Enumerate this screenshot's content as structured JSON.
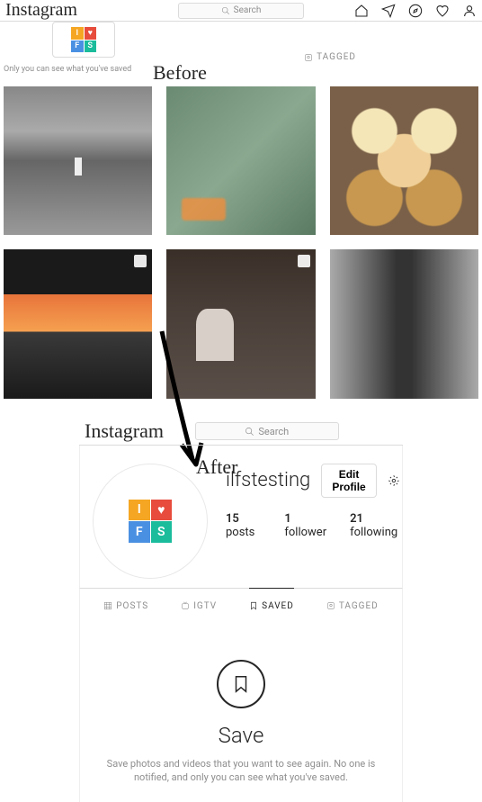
{
  "before_label": "Before",
  "after_label": "After",
  "nav": {
    "brand": "Instagram",
    "search_placeholder": "Search"
  },
  "saved_notice": "Only you can see what you've saved",
  "tagged_label": "TAGGED",
  "grid_items": [
    {
      "name": "bw-cityscape",
      "multi": false
    },
    {
      "name": "green-car-headlight",
      "multi": false
    },
    {
      "name": "food-bowls-flatlay",
      "multi": false
    },
    {
      "name": "sunset-mountain-collage",
      "multi": true
    },
    {
      "name": "workshop-person",
      "multi": true
    },
    {
      "name": "bw-hand-closeup",
      "multi": false
    }
  ],
  "profile": {
    "username": "ilfstesting",
    "edit_label": "Edit Profile",
    "posts_count": "15",
    "posts_label": "posts",
    "followers_count": "1",
    "followers_label": "follower",
    "following_count": "21",
    "following_label": "following"
  },
  "tabs": {
    "posts": "POSTS",
    "igtv": "IGTV",
    "saved": "SAVED",
    "tagged": "TAGGED"
  },
  "empty": {
    "title": "Save",
    "desc": "Save photos and videos that you want to see again. No one is notified, and only you can see what you've saved."
  },
  "avatar_cells": {
    "i": "I",
    "heart": "♥",
    "f": "F",
    "s": "S"
  }
}
